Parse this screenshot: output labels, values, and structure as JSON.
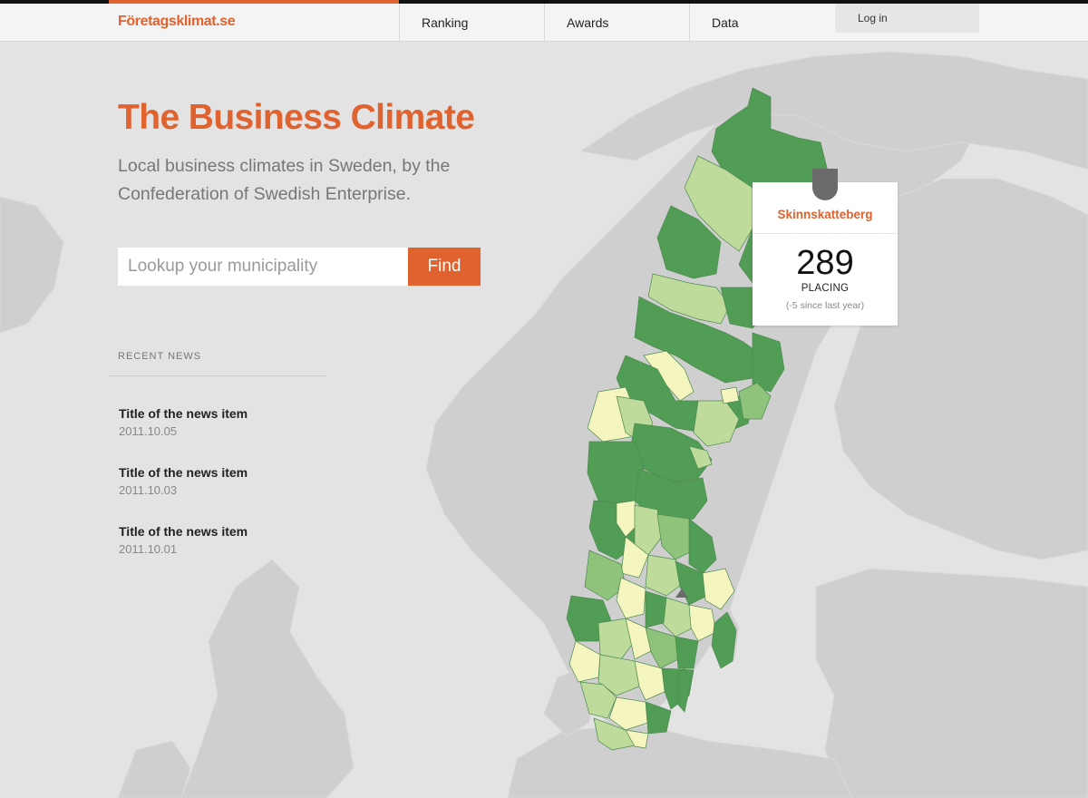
{
  "header": {
    "logo": "Företagsklimat.se",
    "nav": [
      {
        "label": "Ranking"
      },
      {
        "label": "Awards"
      },
      {
        "label": "Data"
      }
    ],
    "login": "Log in",
    "accent_color": "#e0622e"
  },
  "hero": {
    "title": "The Business Climate",
    "subtitle": "Local business climates in Sweden, by the Confederation of Swedish Enterprise."
  },
  "search": {
    "placeholder": "Lookup your municipality",
    "value": "",
    "button_label": "Find"
  },
  "news": {
    "heading": "RECENT NEWS",
    "items": [
      {
        "title": "Title of the news item",
        "date": "2011.10.05"
      },
      {
        "title": "Title of the news item",
        "date": "2011.10.03"
      },
      {
        "title": "Title of the news item",
        "date": "2011.10.01"
      }
    ]
  },
  "callout": {
    "municipality": "Skinnskatteberg",
    "rank": "289",
    "label": "PLACING",
    "change": "(-5 since last year)"
  },
  "map": {
    "land_color": "#cfcfcf",
    "sea_color": "#e3e3e3",
    "colors": {
      "dark_green": "#529d55",
      "mid_green": "#8fc27a",
      "light_green": "#bfdb9c",
      "pale_yellow": "#f5f5bf"
    }
  }
}
